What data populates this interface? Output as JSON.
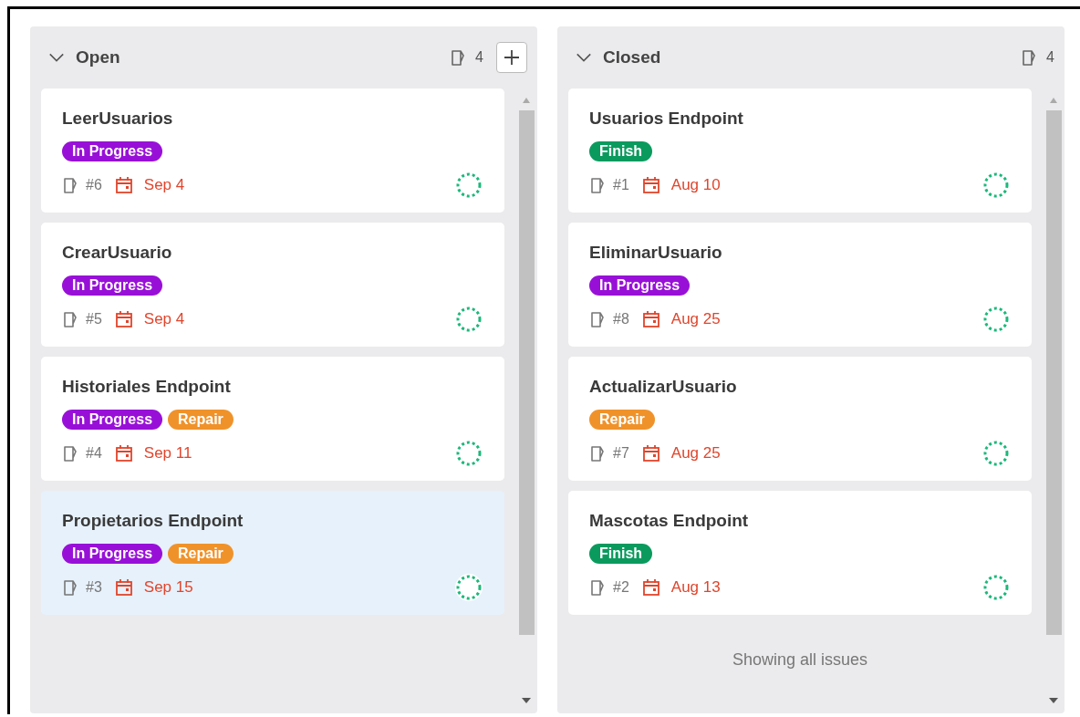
{
  "columns": [
    {
      "title": "Open",
      "expanded": true,
      "count": "4",
      "add_button": true,
      "cards": [
        {
          "title": "LeerUsuarios",
          "selected": false,
          "labels": [
            {
              "text": "In Progress",
              "color": "#9810d8"
            }
          ],
          "number": "#6",
          "date": "Sep 4"
        },
        {
          "title": "CrearUsuario",
          "selected": false,
          "labels": [
            {
              "text": "In Progress",
              "color": "#9810d8"
            }
          ],
          "number": "#5",
          "date": "Sep 4"
        },
        {
          "title": "Historiales Endpoint",
          "selected": false,
          "labels": [
            {
              "text": "In Progress",
              "color": "#9810d8"
            },
            {
              "text": "Repair",
              "color": "#f0922a"
            }
          ],
          "number": "#4",
          "date": "Sep 11"
        },
        {
          "title": "Propietarios Endpoint",
          "selected": true,
          "labels": [
            {
              "text": "In Progress",
              "color": "#9810d8"
            },
            {
              "text": "Repair",
              "color": "#f0922a"
            }
          ],
          "number": "#3",
          "date": "Sep 15"
        }
      ]
    },
    {
      "title": "Closed",
      "expanded": true,
      "count": "4",
      "add_button": false,
      "footer": "Showing all issues",
      "cards": [
        {
          "title": "Usuarios Endpoint",
          "selected": false,
          "labels": [
            {
              "text": "Finish",
              "color": "#0b9a5e"
            }
          ],
          "number": "#1",
          "date": "Aug 10"
        },
        {
          "title": "EliminarUsuario",
          "selected": false,
          "labels": [
            {
              "text": "In Progress",
              "color": "#9810d8"
            }
          ],
          "number": "#8",
          "date": "Aug 25"
        },
        {
          "title": "ActualizarUsuario",
          "selected": false,
          "labels": [
            {
              "text": "Repair",
              "color": "#f0922a"
            }
          ],
          "number": "#7",
          "date": "Aug 25"
        },
        {
          "title": "Mascotas Endpoint",
          "selected": false,
          "labels": [
            {
              "text": "Finish",
              "color": "#0b9a5e"
            }
          ],
          "number": "#2",
          "date": "Aug 13"
        }
      ]
    }
  ]
}
